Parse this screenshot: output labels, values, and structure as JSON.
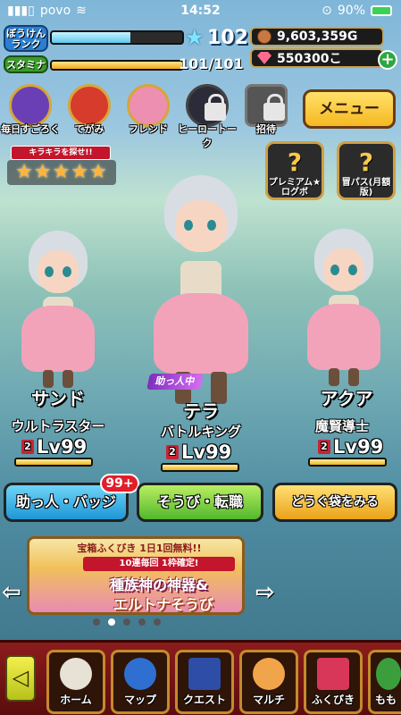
{
  "status_bar": {
    "carrier": "povo",
    "time": "14:52",
    "battery": "90%"
  },
  "hud": {
    "rank_label": "ぼうけんランク",
    "rank_value": "102",
    "rank_progress": 0.6,
    "stamina_label": "スタミナ",
    "stamina_value": "101/101",
    "stamina_progress": 1.0,
    "gold": "9,603,359G",
    "gems": "550300こ",
    "add_label": "+"
  },
  "icon_row": [
    {
      "label": "毎日すごろく",
      "color": "#6a3fb5"
    },
    {
      "label": "てがみ",
      "color": "#d63b2b"
    },
    {
      "label": "フレンド",
      "color": "#ec8fb0"
    },
    {
      "label": "ヒーロートーク",
      "color": "#2b2b3a"
    },
    {
      "label": "招待",
      "color": "#555555"
    }
  ],
  "menu_button": "メニュー",
  "kira_banner": {
    "title": "キラキラを探せ!!",
    "stars": "★★★★★"
  },
  "side_buttons": [
    {
      "symbol": "?",
      "label": "プレミアム★ログボ"
    },
    {
      "symbol": "?",
      "label": "冒パス(月額版)"
    }
  ],
  "party": [
    {
      "name": "サンド",
      "job": "ウルトラスター",
      "gender_mark": "2",
      "level": "Lv99"
    },
    {
      "name": "テラ",
      "job": "バトルキング",
      "gender_mark": "2",
      "level": "Lv99",
      "tag": "助っ人中"
    },
    {
      "name": "アクア",
      "job": "魔賢導士",
      "gender_mark": "2",
      "level": "Lv99"
    }
  ],
  "actions": {
    "helper": "助っ人・バッジ",
    "helper_badge": "99+",
    "equip": "そうび・転職",
    "bag": "どうぐ袋をみる"
  },
  "banner": {
    "line1": "宝箱ふくびき 1日1回無料!!",
    "line2": "10連毎回 1枠確定!",
    "line3": "種族神の神器&",
    "line4": "エルトナそうび",
    "pages": 5,
    "current_page": 2
  },
  "bottom_nav": [
    {
      "label": "ホーム",
      "color": "#e7e1d6"
    },
    {
      "label": "マップ",
      "color": "#2f6fd1"
    },
    {
      "label": "クエスト",
      "color": "#2d4da6"
    },
    {
      "label": "マルチ",
      "color": "#f1a54a"
    },
    {
      "label": "ふくびき",
      "color": "#d9375a"
    },
    {
      "label": "もも",
      "color": "#3a9e3c"
    }
  ],
  "colors": {
    "accent": "#f6b821",
    "nav_bg": "#8c1c1c"
  }
}
